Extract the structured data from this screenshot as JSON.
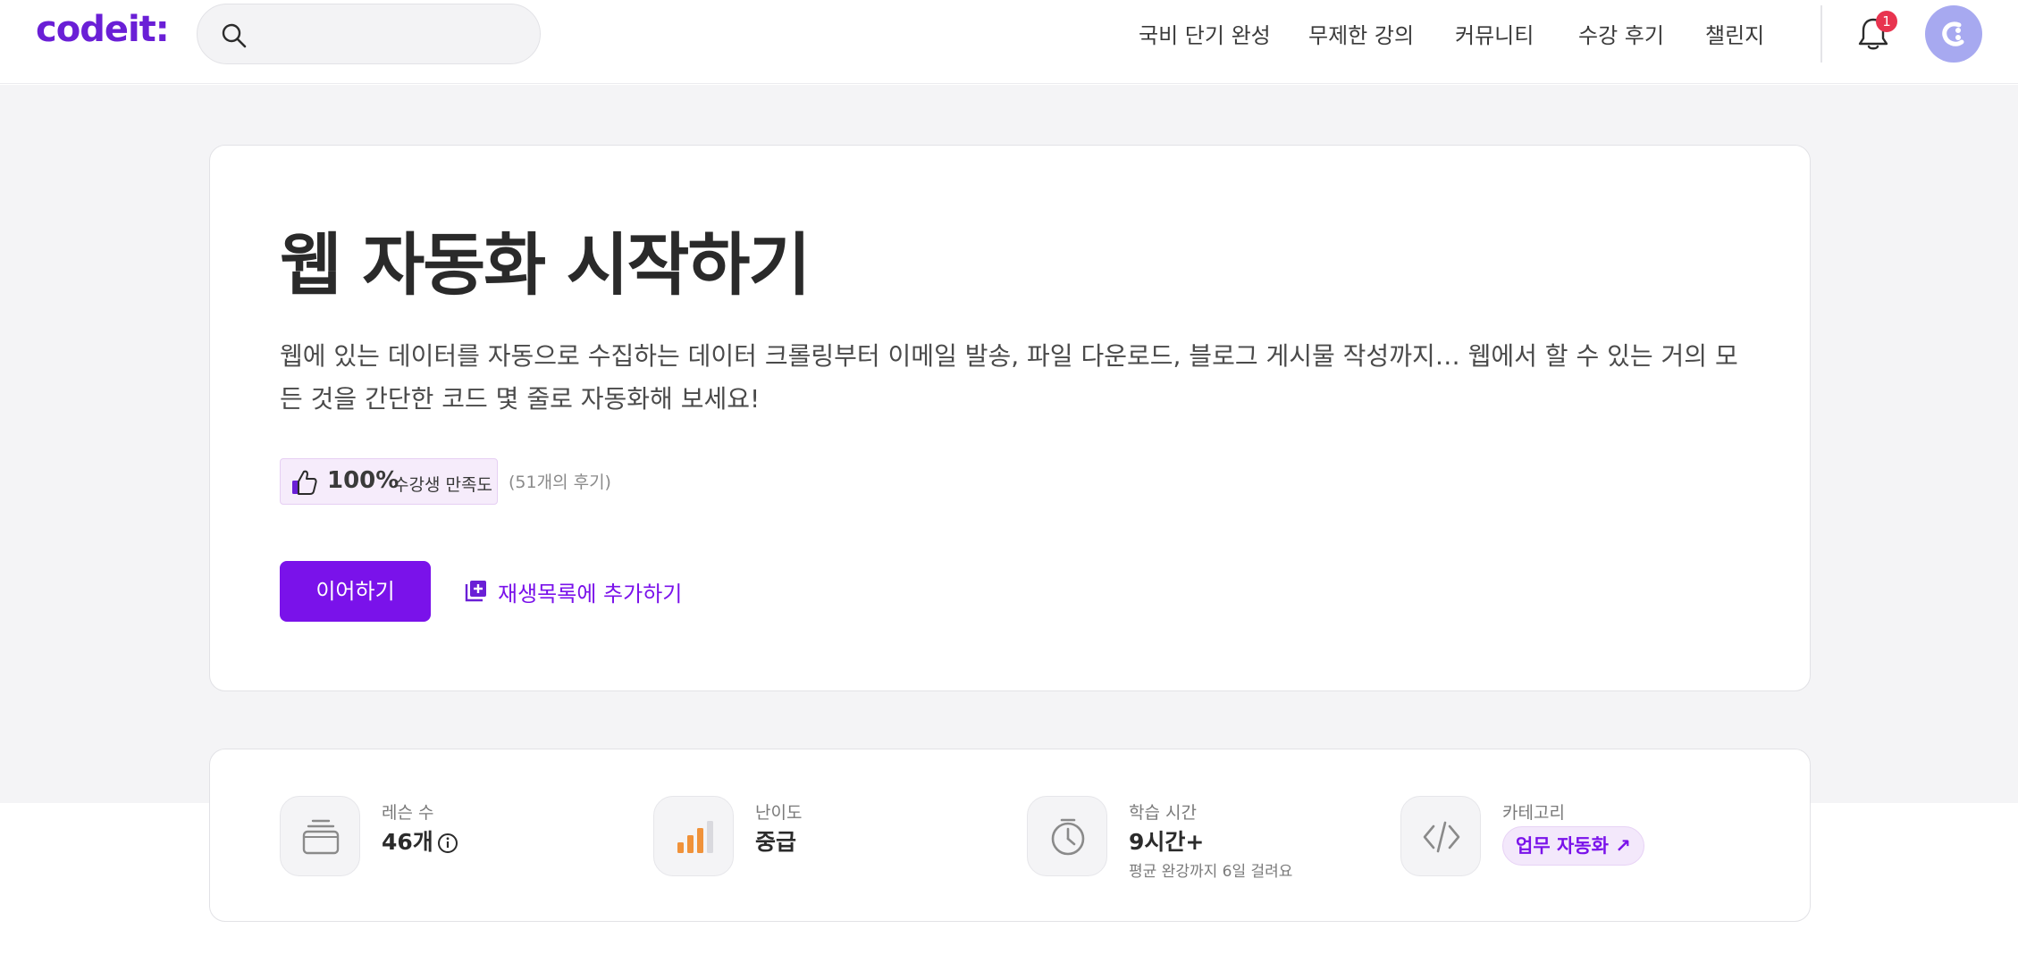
{
  "header": {
    "logo": "codeit:",
    "nav": [
      {
        "label": "국비 단기 완성"
      },
      {
        "label": "무제한 강의"
      },
      {
        "label": "커뮤니티"
      },
      {
        "label": "수강 후기"
      },
      {
        "label": "챌린지"
      }
    ],
    "notification_count": "1"
  },
  "hero": {
    "title": "웹 자동화 시작하기",
    "description": "웹에 있는 데이터를 자동으로 수집하는 데이터 크롤링부터 이메일 발송, 파일 다운로드, 블로그 게시물 작성까지… 웹에서 할 수 있는 거의 모든 것을 간단한 코드 몇 줄로 자동화해 보세요!",
    "rating_percent": "100%",
    "rating_label": "수강생 만족도",
    "review_count": "(51개의 후기)",
    "continue_button": "이어하기",
    "add_playlist": "재생목록에 추가하기"
  },
  "info": {
    "lessons": {
      "label": "레슨 수",
      "value": "46개"
    },
    "difficulty": {
      "label": "난이도",
      "value": "중급"
    },
    "study_time": {
      "label": "학습 시간",
      "value": "9시간+",
      "sub": "평균 완강까지 6일 걸려요"
    },
    "category": {
      "label": "카테고리",
      "value": "업무 자동화 ↗"
    }
  },
  "colors": {
    "brand": "#7a12ea",
    "badge": "#e8344f",
    "difficulty": "#f0923a"
  }
}
